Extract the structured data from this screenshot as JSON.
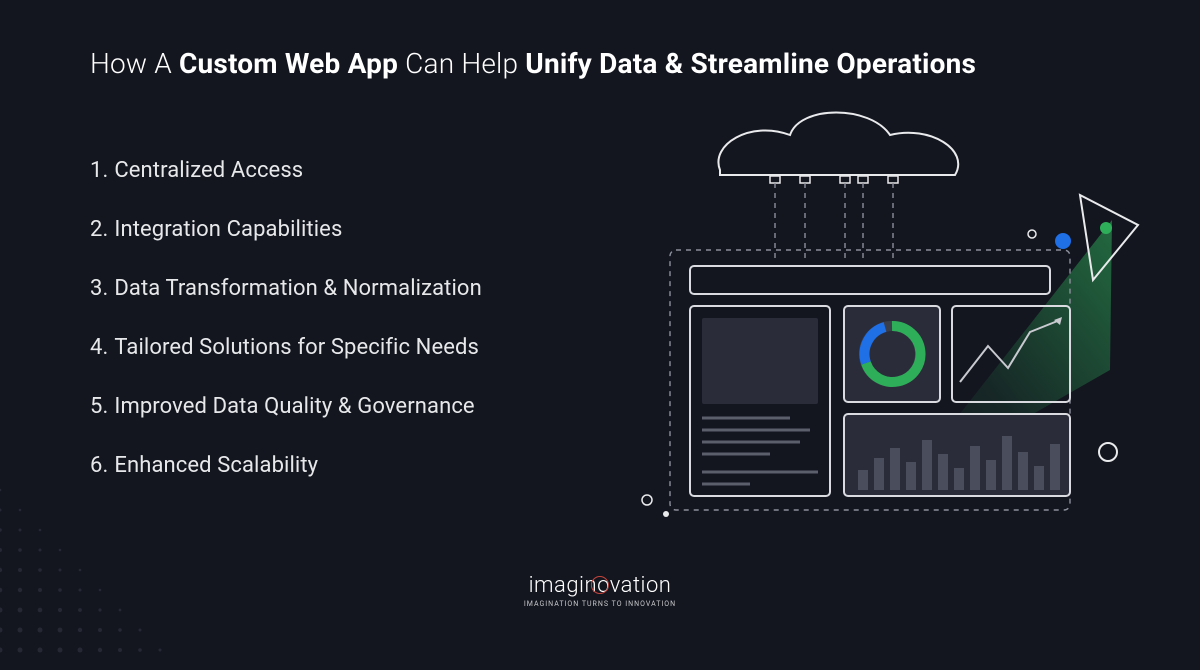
{
  "title": {
    "p1": "How A ",
    "b1": "Custom Web App",
    "p2": " Can Help ",
    "b2": "Unify Data & Streamline Operations"
  },
  "items": [
    {
      "num": "1.",
      "label": "Centralized Access"
    },
    {
      "num": "2.",
      "label": "Integration Capabilities"
    },
    {
      "num": "3.",
      "label": "Data Transformation & Normalization"
    },
    {
      "num": "4.",
      "label": "Tailored Solutions for Specific Needs"
    },
    {
      "num": "5.",
      "label": "Improved Data Quality & Governance"
    },
    {
      "num": "6.",
      "label": "Enhanced Scalability"
    }
  ],
  "logo": {
    "word": "imaginovation",
    "tagline": "IMAGINATION TURNS TO INNOVATION"
  },
  "colors": {
    "bg": "#13151f",
    "text": "#ffffff",
    "stroke": "#b9bdc4",
    "accent_green": "#2fae5a",
    "accent_blue": "#1f6fe7",
    "panel_fill": "#2a2d39",
    "logo_ring": "#c4453c"
  }
}
